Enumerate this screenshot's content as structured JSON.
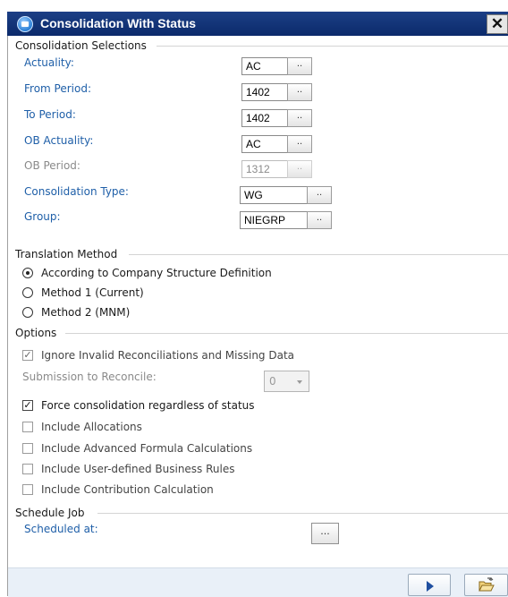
{
  "window": {
    "title": "Consolidation With Status",
    "close_glyph": "✕"
  },
  "sections": {
    "consolidation": "Consolidation Selections",
    "translation": "Translation Method",
    "options": "Options",
    "schedule": "Schedule Job"
  },
  "fields": {
    "actuality": {
      "label": "Actuality:",
      "value": "AC",
      "lookup": ".."
    },
    "from_period": {
      "label": "From Period:",
      "value": "1402",
      "lookup": ".."
    },
    "to_period": {
      "label": "To Period:",
      "value": "1402",
      "lookup": ".."
    },
    "ob_actuality": {
      "label": "OB Actuality:",
      "value": "AC",
      "lookup": ".."
    },
    "ob_period": {
      "label": "OB Period:",
      "value": "1312",
      "lookup": "..",
      "enabled": false
    },
    "consolidation_type": {
      "label": "Consolidation Type:",
      "value": "WG",
      "lookup": ".."
    },
    "group": {
      "label": "Group:",
      "value": "NIEGRP",
      "lookup": ".."
    }
  },
  "translation_methods": [
    {
      "label": "According to Company Structure Definition",
      "selected": true
    },
    {
      "label": "Method 1 (Current)",
      "selected": false
    },
    {
      "label": "Method 2 (MNM)",
      "selected": false
    }
  ],
  "options": {
    "ignore_invalid": {
      "label": "Ignore Invalid Reconciliations and Missing Data",
      "checked": true,
      "enabled": false
    },
    "submission": {
      "label": "Submission to Reconcile:",
      "value": "0",
      "enabled": false
    },
    "force": {
      "label": "Force consolidation regardless of status",
      "checked": true
    },
    "allocations": {
      "label": "Include Allocations",
      "checked": false
    },
    "advanced_formula": {
      "label": "Include Advanced Formula Calculations",
      "checked": false
    },
    "business_rules": {
      "label": "Include User-defined Business Rules",
      "checked": false
    },
    "contribution": {
      "label": "Include Contribution Calculation",
      "checked": false
    }
  },
  "schedule": {
    "label": "Scheduled at:",
    "button": "..."
  },
  "check_glyph": "✓",
  "icons": {
    "app": "app-icon",
    "run": "play-icon",
    "open": "folder-open-icon"
  },
  "colors": {
    "titlebar": "#0b2a6b",
    "label_blue": "#1f5fa8",
    "footer": "#e9f0f8"
  }
}
